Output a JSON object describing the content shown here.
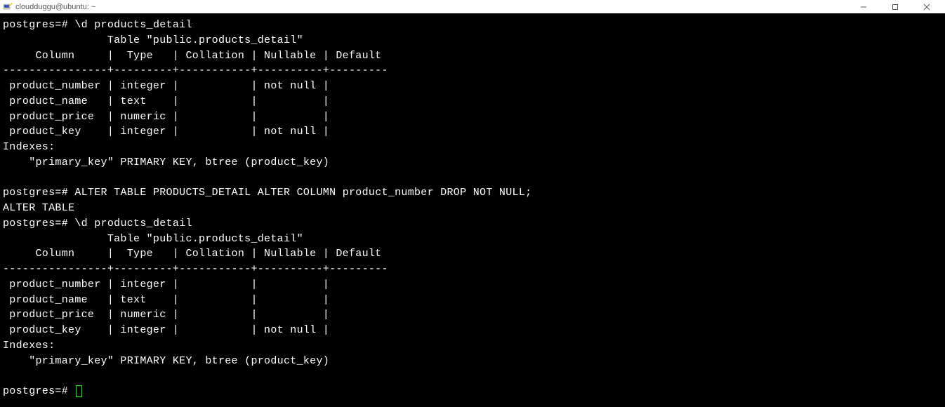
{
  "window": {
    "title": "cloudduggu@ubuntu: ~"
  },
  "terminal": {
    "line1_prompt": "postgres=# ",
    "line1_cmd": "\\d products_detail",
    "table1_title": "                Table \"public.products_detail\"",
    "table1_header": "     Column     |  Type   | Collation | Nullable | Default",
    "table1_sep": "----------------+---------+-----------+----------+---------",
    "table1_row1": " product_number | integer |           | not null |",
    "table1_row2": " product_name   | text    |           |          |",
    "table1_row3": " product_price  | numeric |           |          |",
    "table1_row4": " product_key    | integer |           | not null |",
    "table1_idx_hdr": "Indexes:",
    "table1_idx": "    \"primary_key\" PRIMARY KEY, btree (product_key)",
    "blank": "",
    "line2_prompt": "postgres=# ",
    "line2_cmd": "ALTER TABLE PRODUCTS_DETAIL ALTER COLUMN product_number DROP NOT NULL;",
    "line2_result": "ALTER TABLE",
    "line3_prompt": "postgres=# ",
    "line3_cmd": "\\d products_detail",
    "table2_title": "                Table \"public.products_detail\"",
    "table2_header": "     Column     |  Type   | Collation | Nullable | Default",
    "table2_sep": "----------------+---------+-----------+----------+---------",
    "table2_row1": " product_number | integer |           |          |",
    "table2_row2": " product_name   | text    |           |          |",
    "table2_row3": " product_price  | numeric |           |          |",
    "table2_row4": " product_key    | integer |           | not null |",
    "table2_idx_hdr": "Indexes:",
    "table2_idx": "    \"primary_key\" PRIMARY KEY, btree (product_key)",
    "line4_prompt": "postgres=# "
  }
}
